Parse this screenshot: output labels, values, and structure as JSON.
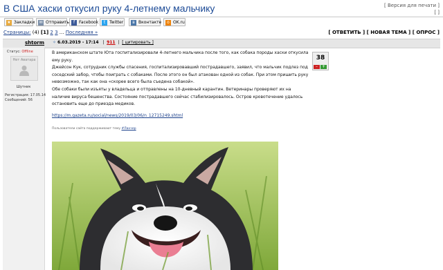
{
  "window": {
    "title": "В США хаски откусил руку 4-летнему мальчику",
    "print_link": "[ Версия для печати ]",
    "extra_link": "[ ]"
  },
  "share": {
    "buttons": [
      {
        "label": "Закладки",
        "icon": "bookmark-icon",
        "color": "#e8a93c"
      },
      {
        "label": "Отправить",
        "icon": "mail-icon",
        "color": "#7a8ea8"
      },
      {
        "label": "Facebook",
        "icon": "facebook-icon",
        "color": "#3b5998"
      },
      {
        "label": "Twitter",
        "icon": "twitter-icon",
        "color": "#2aa3ef"
      },
      {
        "label": "Вконтакте",
        "icon": "vk-icon",
        "color": "#4a76a8"
      },
      {
        "label": "OK.ru",
        "icon": "ok-icon",
        "color": "#ee8208"
      }
    ]
  },
  "pages": {
    "label": "Страницы:",
    "count": "(4)",
    "current": "[1]",
    "p2": "2",
    "p3": "3",
    "dots": "...",
    "last": "Последняя »"
  },
  "actions": {
    "reply": "[ ОТВЕТИТЬ ]",
    "new_topic": "[ НОВАЯ ТЕМА ]",
    "poll": "[ ОПРОС ]"
  },
  "post": {
    "author": "shtorm",
    "date": "6.03.2019 - 17:14",
    "number": "911",
    "quote": "[ цитировать ]",
    "paragraphs": [
      "В американском штате Юта госпитализировали 4-летнего мальчика после того, как собака породы хаски откусила ему руку.",
      "Джейсон Кук, сотрудник службы спасения, госпитализировавший пострадавшего, заявил, что мальчик подлез под соседский забор, чтобы поиграть с собаками. После этого он был атакован одной из собак. При этом пришить руку невозможно, так как она «скорее всего была съедена собакой».",
      "Обе собаки были изъяты у владельца и отправлены на 10-дневный карантин. Ветеринары проверяют их на наличие вируса бешенства. Состояние пострадавшего сейчас стабилизировалось. Остров кровотечение удалось остановить еще до приезда медиков."
    ],
    "link": "https://m.gazeta.ru/social/news/2019/03/06/n_12715249.shtml",
    "note": "Пользователи сайта поддерживают тему",
    "note_tag": "#Ланчер"
  },
  "user": {
    "status_label": "Статус:",
    "status_value": "Offline",
    "avatar_text": "Нет Аватара",
    "rank": "Шутник",
    "reg": "Регистрация: 17.05.14",
    "msgs": "Сообщений: 56"
  },
  "rating": {
    "value": "38",
    "minus": "–",
    "plus": "+"
  },
  "image": {
    "description_icon": "husky-photo"
  }
}
